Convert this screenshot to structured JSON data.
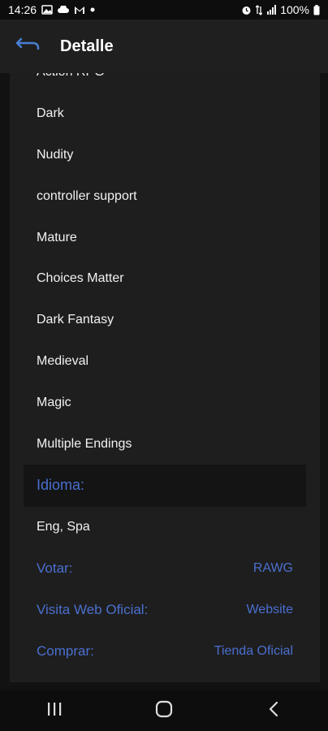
{
  "status_bar": {
    "time": "14:26",
    "battery": "100%"
  },
  "app_bar": {
    "title": "Detalle",
    "back_icon": "back-arrow-icon"
  },
  "tags": {
    "cut_off_item": "Action RPG",
    "items": [
      "Dark",
      "Nudity",
      "controller support",
      "Mature",
      "Choices Matter",
      "Dark Fantasy",
      "Medieval",
      "Magic",
      "Multiple Endings"
    ]
  },
  "language": {
    "header": "Idioma:",
    "value": "Eng, Spa"
  },
  "links": [
    {
      "label": "Votar:",
      "value": "RAWG"
    },
    {
      "label": "Visita Web Oficial:",
      "value": "Website"
    },
    {
      "label": "Comprar:",
      "value": "Tienda Oficial"
    }
  ],
  "colors": {
    "accent": "#4a6fcf",
    "background": "#121212",
    "card": "#1e1e1e",
    "header_bg": "#141414"
  }
}
